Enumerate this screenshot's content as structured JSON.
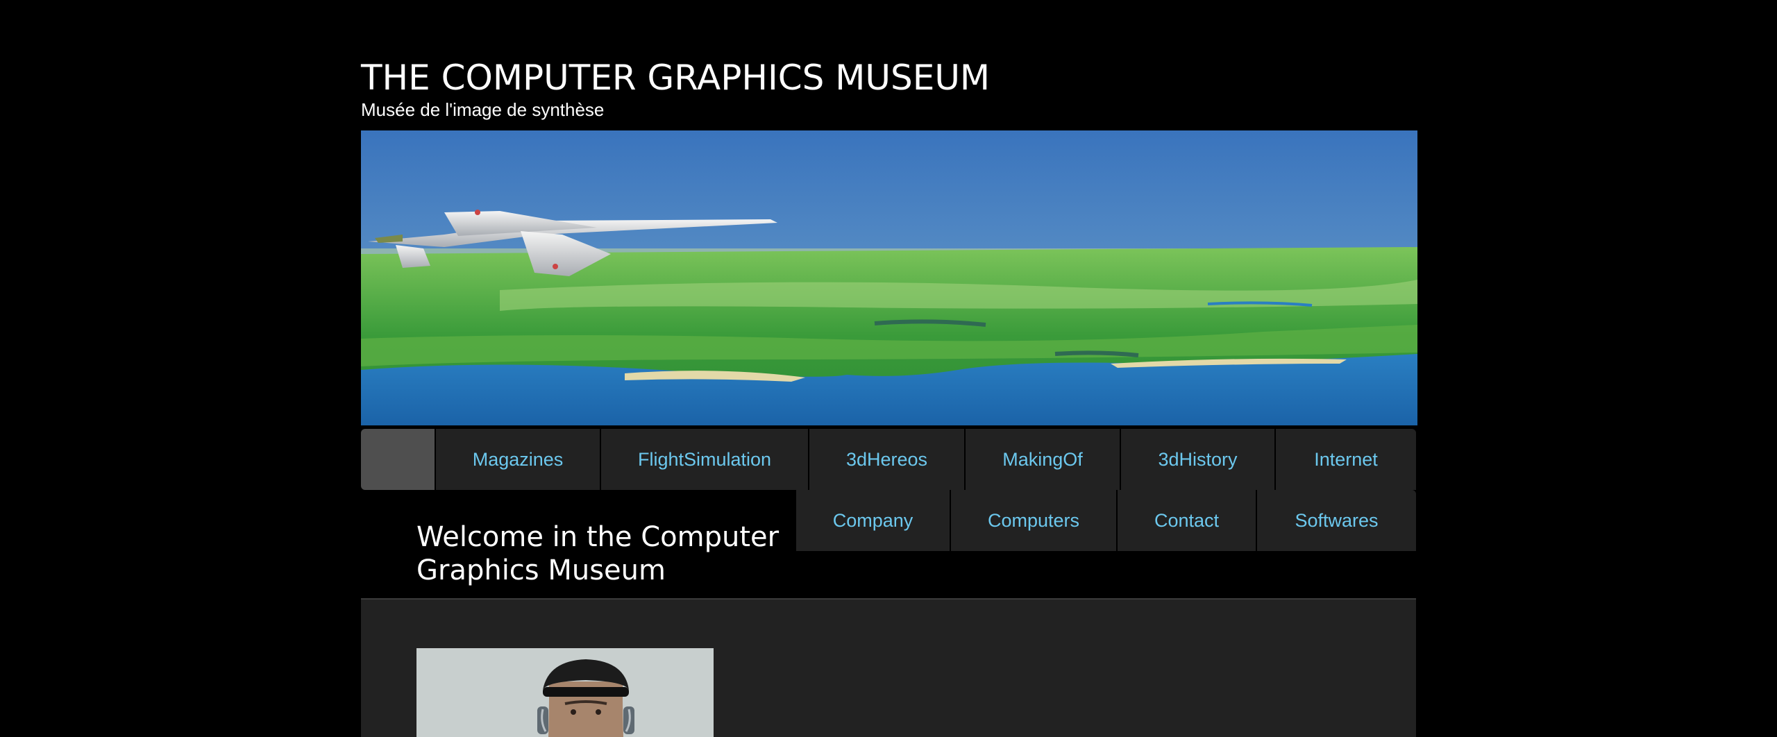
{
  "header": {
    "title": "THE COMPUTER GRAPHICS MUSEUM",
    "subtitle": "Musée de l'image de synthèse"
  },
  "banner": {
    "image": "flight-simulation-jet-over-landscape"
  },
  "nav": {
    "row1": [
      {
        "label": "Magazines"
      },
      {
        "label": "FlightSimulation"
      },
      {
        "label": "3dHereos"
      },
      {
        "label": "MakingOf"
      },
      {
        "label": "3dHistory"
      },
      {
        "label": "Internet"
      }
    ],
    "row2": [
      {
        "label": "Company"
      },
      {
        "label": "Computers"
      },
      {
        "label": "Contact"
      },
      {
        "label": "Softwares"
      }
    ],
    "link_color": "#6cc8ee",
    "item_bg": "#222222",
    "home_bg": "#4f4f4f"
  },
  "main": {
    "heading": "Welcome in the Computer Graphics Museum",
    "portrait": "person-with-headphones-photo"
  }
}
